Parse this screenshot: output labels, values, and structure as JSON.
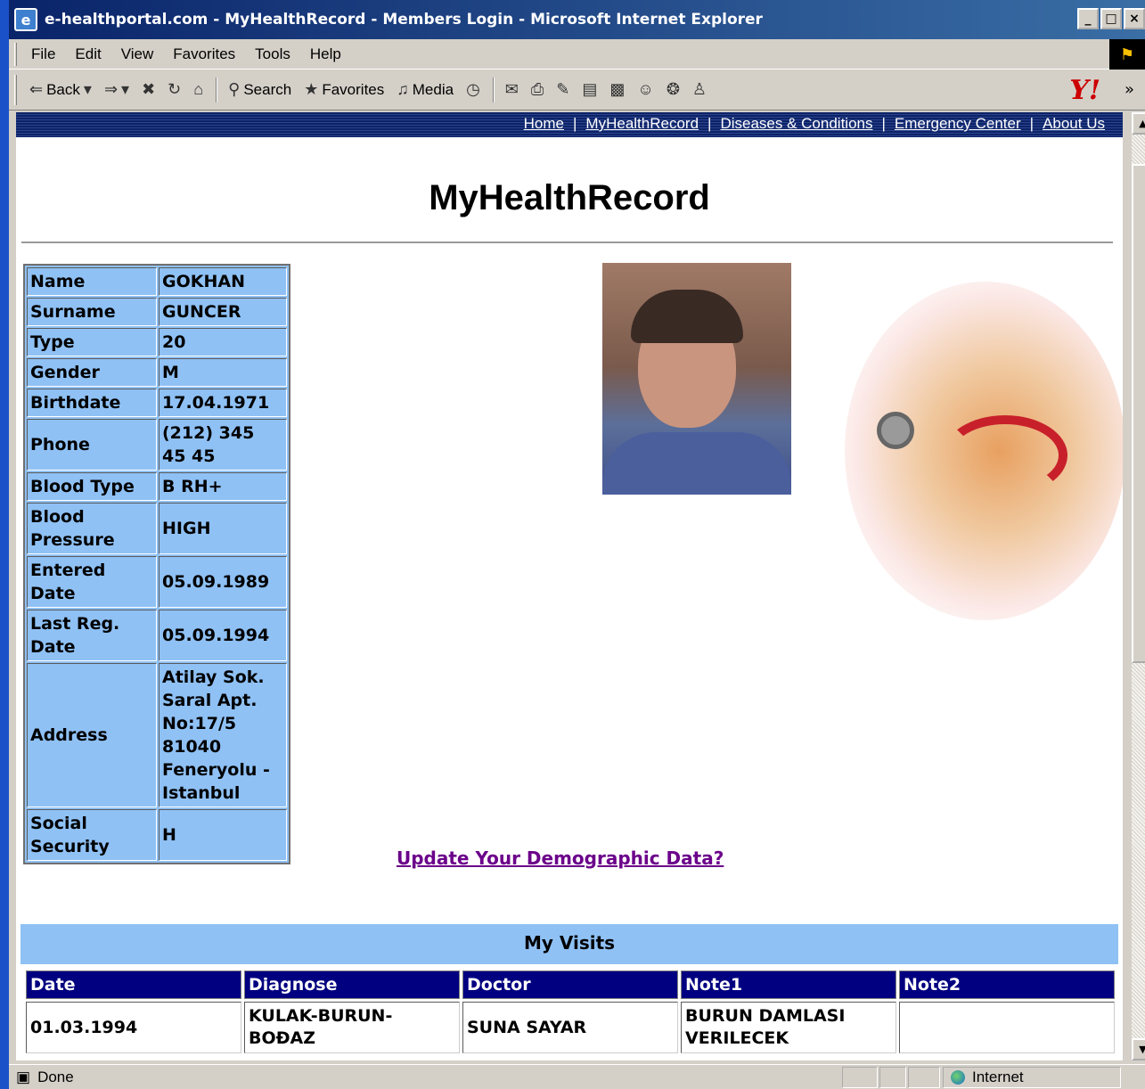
{
  "window": {
    "title": "e-healthportal.com - MyHealthRecord - Members Login - Microsoft Internet Explorer",
    "controls": [
      "_",
      "□",
      "×"
    ]
  },
  "menu": [
    "File",
    "Edit",
    "View",
    "Favorites",
    "Tools",
    "Help"
  ],
  "toolbar": {
    "back": "Back",
    "search": "Search",
    "favorites": "Favorites",
    "media": "Media"
  },
  "topnav": {
    "links": [
      "Home",
      "MyHealthRecord",
      "Diseases & Conditions",
      "Emergency Center",
      "About Us"
    ],
    "separator": "|"
  },
  "page_title": "MyHealthRecord",
  "profile": [
    {
      "label": "Name",
      "value": "GOKHAN"
    },
    {
      "label": "Surname",
      "value": "GUNCER"
    },
    {
      "label": "Type",
      "value": "20"
    },
    {
      "label": "Gender",
      "value": "M"
    },
    {
      "label": "Birthdate",
      "value": "17.04.1971"
    },
    {
      "label": "Phone",
      "value": "(212) 345 45 45"
    },
    {
      "label": "Blood Type",
      "value": "B RH+"
    },
    {
      "label": "Blood Pressure",
      "value": "HIGH"
    },
    {
      "label": "Entered Date",
      "value": "05.09.1989"
    },
    {
      "label": "Last Reg. Date",
      "value": "05.09.1994"
    },
    {
      "label": "Address",
      "value": "Atilay Sok. Saral Apt. No:17/5 81040 Feneryolu - Istanbul"
    },
    {
      "label": "Social Security",
      "value": "H"
    }
  ],
  "update_link": "Update Your Demographic Data?",
  "visits": {
    "title": "My Visits",
    "columns": [
      "Date",
      "Diagnose",
      "Doctor",
      "Note1",
      "Note2"
    ],
    "rows": [
      [
        "01.03.1994",
        "KULAK-BURUN-BOĐAZ",
        "SUNA SAYAR",
        "BURUN DAMLASI VERILECEK",
        ""
      ]
    ]
  },
  "status": {
    "text": "Done",
    "zone": "Internet"
  },
  "colors": {
    "accent_blue": "#8fc1f5",
    "header_navy": "#000080",
    "link_purple": "#6b008a"
  }
}
